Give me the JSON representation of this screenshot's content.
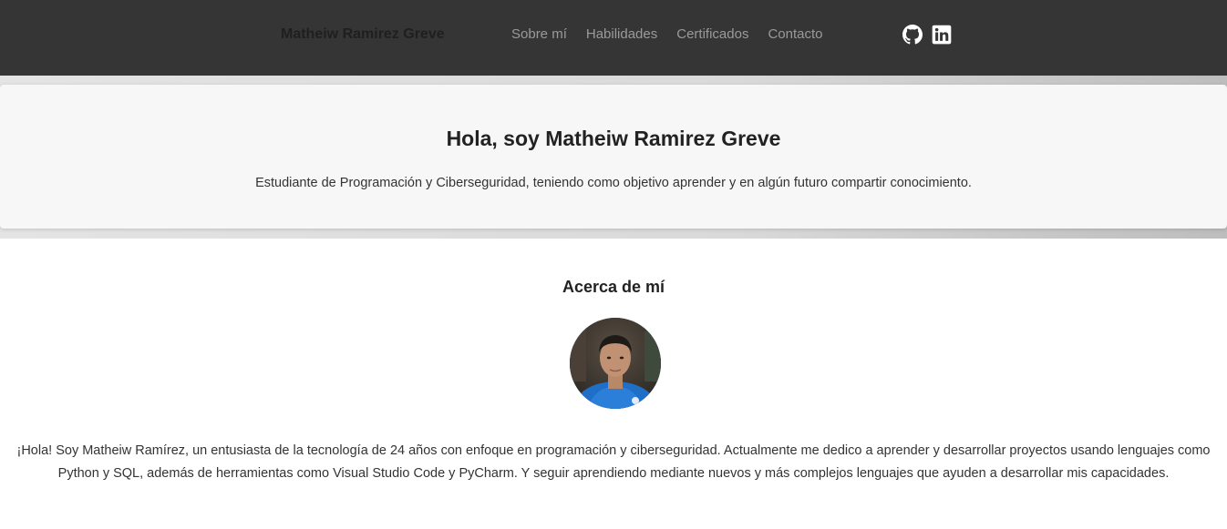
{
  "navbar": {
    "brand": "Matheiw Ramirez Greve",
    "links": [
      {
        "label": "Sobre mí"
      },
      {
        "label": "Habilidades"
      },
      {
        "label": "Certificados"
      },
      {
        "label": "Contacto"
      }
    ],
    "socials": [
      {
        "icon": "github-icon"
      },
      {
        "icon": "linkedin-icon"
      }
    ]
  },
  "hero": {
    "title": "Hola, soy Matheiw Ramirez Greve",
    "subtitle": "Estudiante de Programación y Ciberseguridad, teniendo como objetivo aprender y en algún futuro compartir conocimiento."
  },
  "about": {
    "title": "Acerca de mí",
    "text": "¡Hola! Soy Matheiw Ramírez, un entusiasta de la tecnología de 24 años con enfoque en programación y ciberseguridad. Actualmente me dedico a aprender y desarrollar proyectos usando lenguajes como Python y SQL, además de herramientas como Visual Studio Code y PyCharm. Y seguir aprendiendo mediante nuevos y más complejos lenguajes que ayuden a desarrollar mis capacidades."
  },
  "colors": {
    "navbar_bg": "#353535",
    "nav_link": "#9a9a9a",
    "hero_bg": "#f7f7f7"
  }
}
